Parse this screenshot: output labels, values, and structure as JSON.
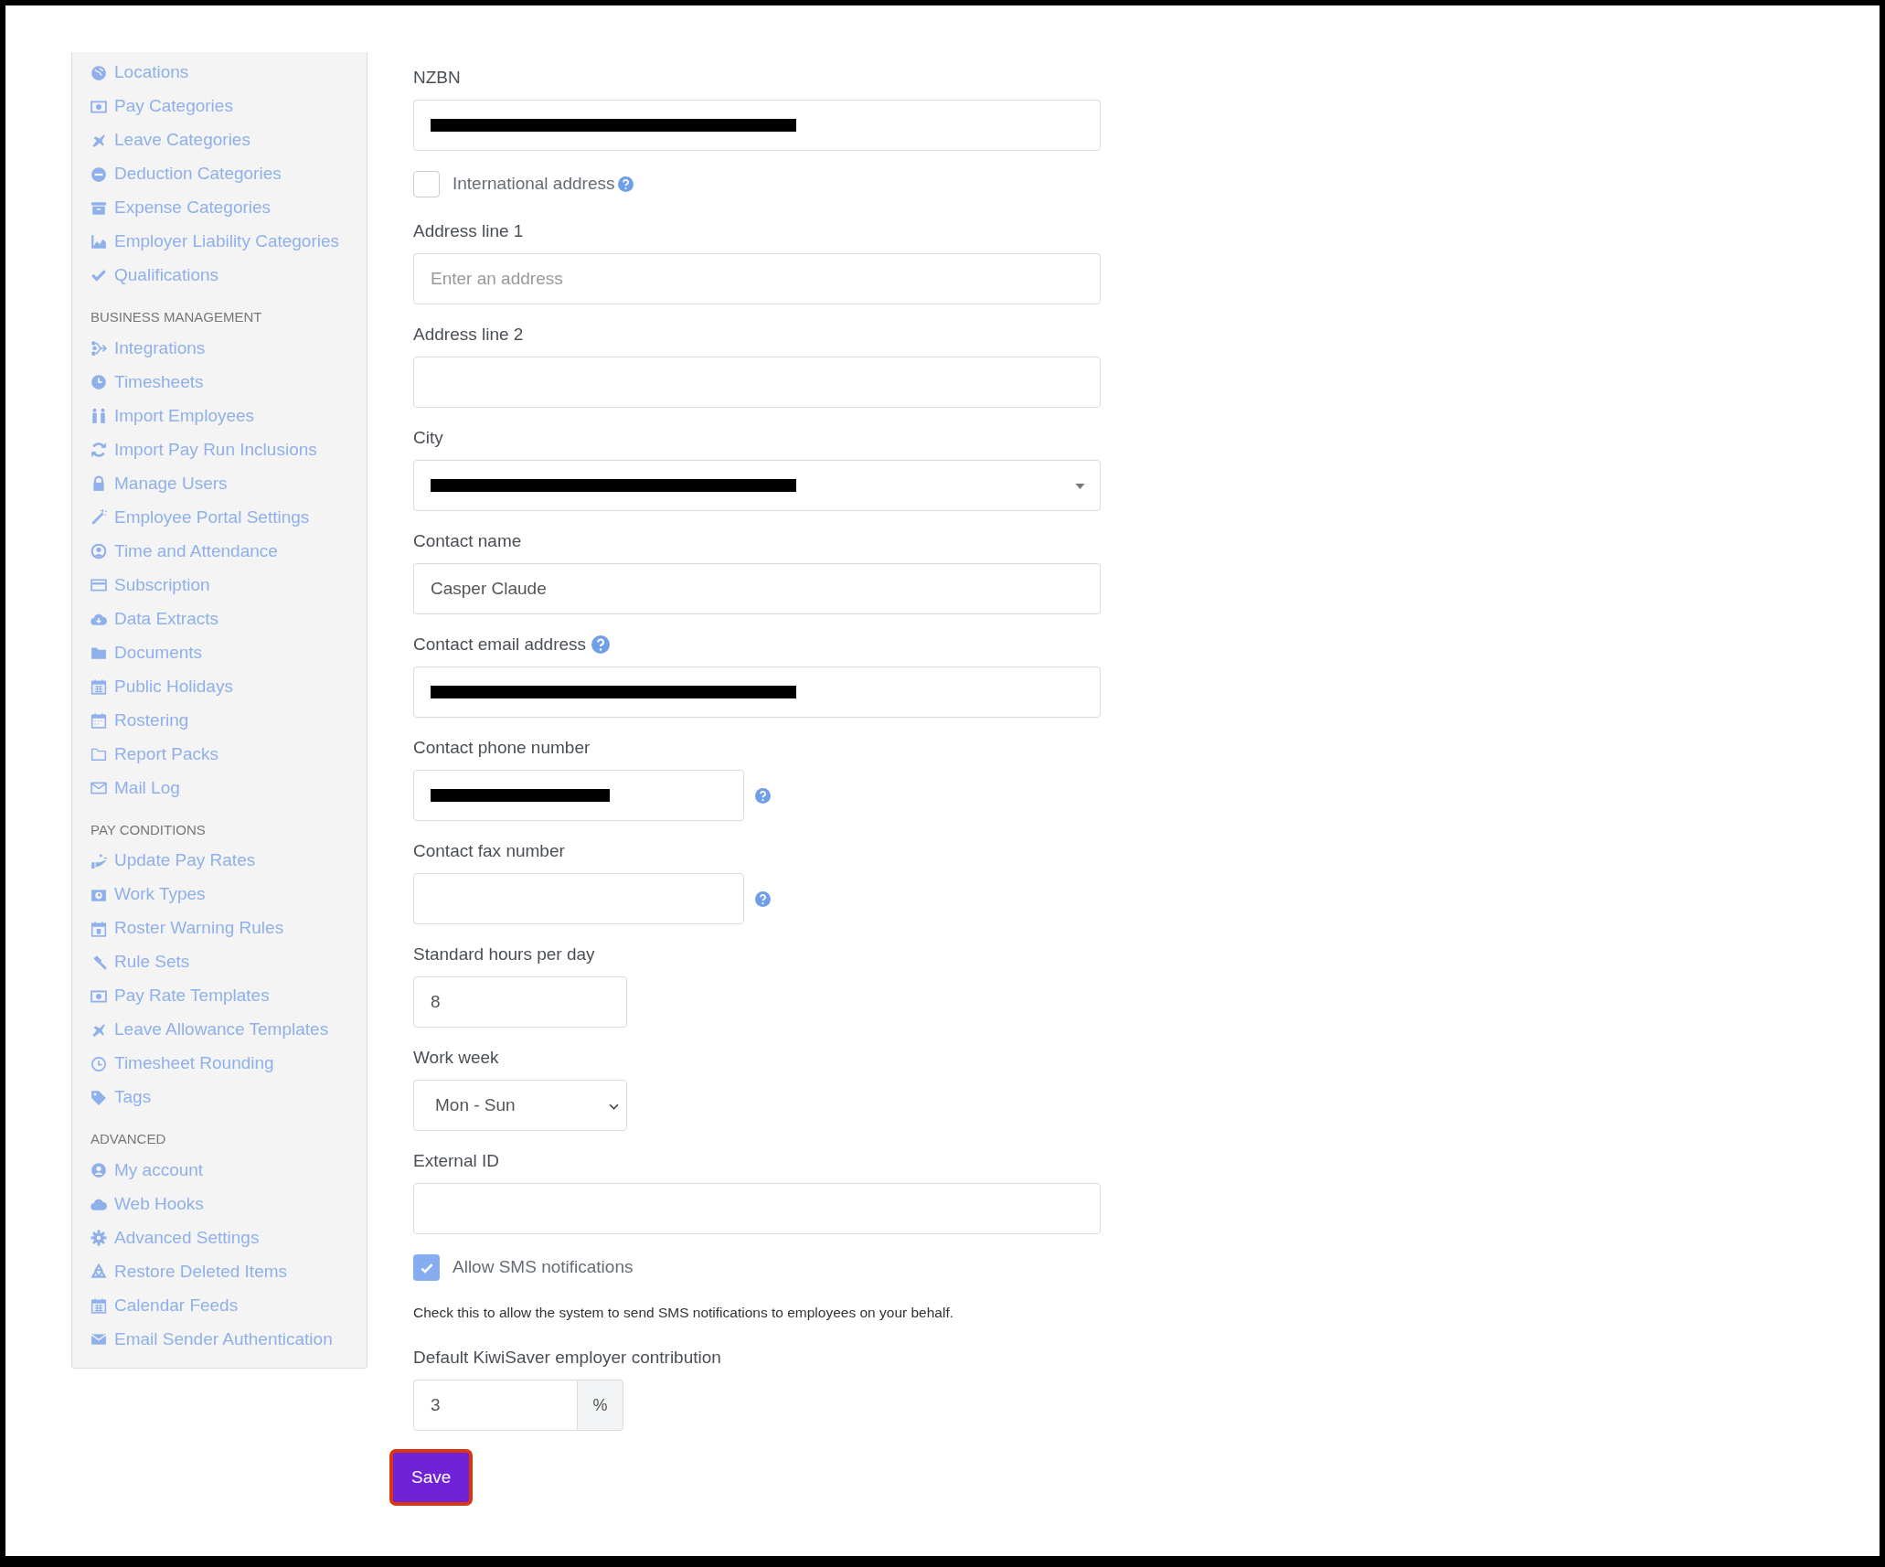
{
  "sidebar": {
    "groups": [
      {
        "items": [
          "Locations",
          "Pay Categories",
          "Leave Categories",
          "Deduction Categories",
          "Expense Categories",
          "Employer Liability Categories",
          "Qualifications"
        ]
      },
      {
        "heading": "BUSINESS MANAGEMENT",
        "items": [
          "Integrations",
          "Timesheets",
          "Import Employees",
          "Import Pay Run Inclusions",
          "Manage Users",
          "Employee Portal Settings",
          "Time and Attendance",
          "Subscription",
          "Data Extracts",
          "Documents",
          "Public Holidays",
          "Rostering",
          "Report Packs",
          "Mail Log"
        ]
      },
      {
        "heading": "PAY CONDITIONS",
        "items": [
          "Update Pay Rates",
          "Work Types",
          "Roster Warning Rules",
          "Rule Sets",
          "Pay Rate Templates",
          "Leave Allowance Templates",
          "Timesheet Rounding",
          "Tags"
        ]
      },
      {
        "heading": "ADVANCED",
        "items": [
          "My account",
          "Web Hooks",
          "Advanced Settings",
          "Restore Deleted Items",
          "Calendar Feeds",
          "Email Sender Authentication"
        ]
      }
    ]
  },
  "form": {
    "fields": [
      {
        "kind": "text",
        "label": "NZBN",
        "redacted": true
      },
      {
        "kind": "checkbox",
        "label": "International address",
        "checked": false,
        "help": true
      },
      {
        "kind": "text",
        "label": "Address line 1",
        "placeholder": "Enter an address"
      },
      {
        "kind": "text",
        "label": "Address line 2"
      },
      {
        "kind": "combo",
        "label": "City",
        "redacted": true
      },
      {
        "kind": "text",
        "label": "Contact name",
        "value": "Casper Claude"
      },
      {
        "kind": "text",
        "label": "Contact email address",
        "help": true,
        "redacted": true
      },
      {
        "kind": "phone",
        "label": "Contact phone number",
        "help": true,
        "redacted": true
      },
      {
        "kind": "phone",
        "label": "Contact fax number",
        "help": true
      },
      {
        "kind": "short",
        "label": "Standard hours per day",
        "value": "8"
      },
      {
        "kind": "select",
        "label": "Work week",
        "value": "Mon - Sun"
      },
      {
        "kind": "text",
        "label": "External ID"
      },
      {
        "kind": "checkbox",
        "label": "Allow SMS notifications",
        "checked": true
      },
      {
        "kind": "note",
        "text": "Check this to allow the system to send SMS notifications to employees on your behalf."
      },
      {
        "kind": "percent",
        "label": "Default KiwiSaver employer contribution",
        "value": "3",
        "suffix": "%"
      }
    ],
    "button": "Save"
  }
}
